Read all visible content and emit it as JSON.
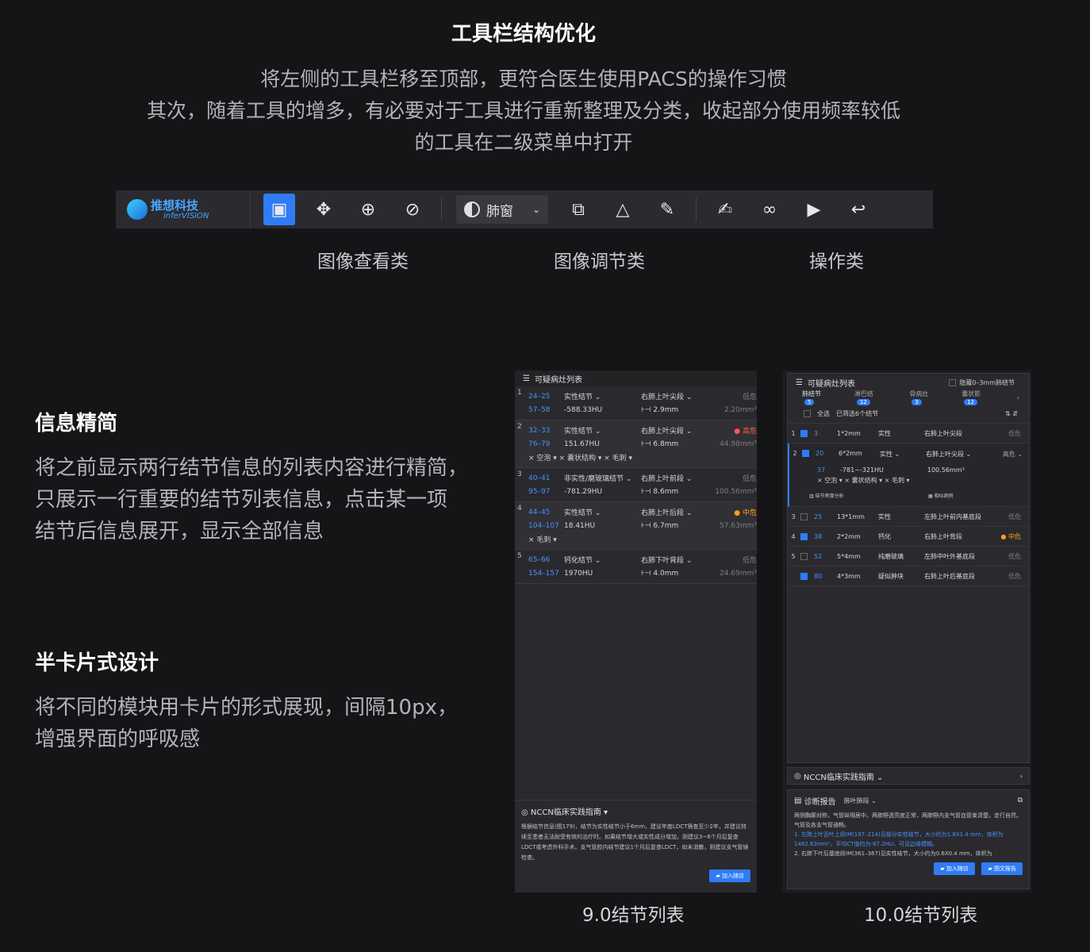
{
  "header": {
    "title": "工具栏结构优化",
    "desc_lines": [
      "将左侧的工具栏移至顶部，更符合医生使用PACS的操作习惯",
      "其次，随着工具的增多，有必要对于工具进行重新整理及分类，收起部分使用频率较低",
      "的工具在二级菜单中打开"
    ]
  },
  "toolbar": {
    "logo_cn": "推想科技",
    "logo_en": "inferVISION",
    "window_label": "肺窗",
    "categories": [
      "图像查看类",
      "图像调节类",
      "操作类"
    ]
  },
  "sections": [
    {
      "title": "信息精简",
      "lines": [
        "将之前显示两行结节信息的列表内容进行精简，",
        "只展示一行重要的结节列表信息，点击某一项",
        "结节后信息展开，显示全部信息"
      ]
    },
    {
      "title": "半卡片式设计",
      "lines": [
        "将不同的模块用卡片的形式展现，间隔10px，",
        "增强界面的呼吸感"
      ]
    }
  ],
  "p9": {
    "header": "可疑病灶列表",
    "rows": [
      {
        "n": "1",
        "a1": "24–25",
        "a2": "实性结节 ⌄",
        "a3": "右肺上叶尖段 ⌄",
        "a4": "低危",
        "b1": "57–58",
        "b2": "-588.33HU",
        "b3": "⊦⊣ 2.9mm",
        "b4": "2.20mm³",
        "tags": ""
      },
      {
        "n": "2",
        "a1": "32–33",
        "a2": "实性结节 ⌄",
        "a3": "右肺上叶尖段 ⌄",
        "a4": "● 高危",
        "b1": "76–79",
        "b2": "151.67HU",
        "b3": "⊦⊣ 6.8mm",
        "b4": "44.98mm³",
        "tags": "× 空泡 ▾   × 囊状结构 ▾   × 毛刺 ▾"
      },
      {
        "n": "3",
        "a1": "40–41",
        "a2": "非实性/磨玻璃结节 ⌄",
        "a3": "右肺上叶前段 ⌄",
        "a4": "低危",
        "b1": "95–97",
        "b2": "-781.29HU",
        "b3": "⊦⊣ 8.6mm",
        "b4": "100.56mm³",
        "tags": ""
      },
      {
        "n": "4",
        "a1": "44–45",
        "a2": "实性结节 ⌄",
        "a3": "右肺上叶后段 ⌄",
        "a4": "● 中危",
        "b1": "104–107",
        "b2": "18.41HU",
        "b3": "⊦⊣ 6.7mm",
        "b4": "57.63mm³",
        "tags": "× 毛刺 ▾"
      },
      {
        "n": "5",
        "a1": "65–66",
        "a2": "钙化结节 ⌄",
        "a3": "右肺下叶背段 ⌄",
        "a4": "低危",
        "b1": "154–157",
        "b2": "1970HU",
        "b3": "⊦⊣ 4.0mm",
        "b4": "24.69mm³",
        "tags": ""
      }
    ],
    "nccn_title": "NCCN临床实践指南 ▾",
    "nccn_text": "根据结节信息(图179)，结节为实性结节小于6mm，建议年度LDCT筛查至少2年，并建议持续至患者无法耐受有效的治疗时。如果结节增大或实性成分增加，则建议3~6个月后复查LDCT或考虑外科手术。支气管腔内结节建议1个月后复查LDCT，如未消散，则建议支气管镜检查。",
    "button": "加入随访"
  },
  "p10": {
    "header": "可疑病灶列表",
    "hide_label": "隐藏0–3mm肺结节",
    "tabs": [
      {
        "label": "肺结节",
        "count": "5"
      },
      {
        "label": "淋巴结",
        "count": "12"
      },
      {
        "label": "骨病灶",
        "count": "3"
      },
      {
        "label": "囊状影",
        "count": "12"
      }
    ],
    "select_all": "全选",
    "filter_text": "已筛选6个结节",
    "rows": [
      {
        "n": "1",
        "c": "3",
        "s": "1*2mm",
        "t": "实性",
        "l": "右肺上叶尖段",
        "r": "低危"
      },
      {
        "n": "2",
        "c": "20",
        "s": "6*2mm",
        "t": "实性 ⌄",
        "l": "右肺上叶尖段 ⌄",
        "r": "高危 ⌄"
      },
      {
        "n": "3",
        "c": "25",
        "s": "13*1mm",
        "t": "实性",
        "l": "左肺上叶前内基底段",
        "r": "低危"
      },
      {
        "n": "4",
        "c": "38",
        "s": "2*2mm",
        "t": "钙化",
        "l": "右肺上叶背段",
        "r": "● 中危"
      },
      {
        "n": "5",
        "c": "52",
        "s": "5*4mm",
        "t": "纯磨玻璃",
        "l": "左肺中叶外基底段",
        "r": "低危"
      },
      {
        "n": "",
        "c": "80",
        "s": "4*3mm",
        "t": "疑似肿块",
        "l": "右肺上叶后基底段",
        "r": "低危"
      }
    ],
    "expanded": {
      "c": "37",
      "hu": "-781~-321HU",
      "vol": "100.56mm³",
      "tags": "× 空泡 ▾   × 囊状结构 ▾   × 毛刺 ▾",
      "a1": "结节密度分析",
      "a2": "相似病例"
    },
    "nccn_title": "NCCN临床实践指南 ⌄",
    "report_title": "诊断报告",
    "report_sel": "肺叶肺段 ⌄",
    "report_text1": "两侧胸廓对称，气管纵隔居中。两肺野透亮度正常，两肺野内支气管血管束清楚，走行自然。气管及各支气管通畅。",
    "report_text2": "1. 左肺上叶舌叶上段IM(197–214)见部分实性结节，大小约为1.8X1.4 mm，体积为1462.63mm³，平均CT值约为-67.2HU，可见边缘模糊。",
    "report_text3": "2. 右肺下叶后基底段IM(361–367)见实性结节，大小约为0.6X0.4 mm，体积为",
    "btn1": "加入随访",
    "btn2": "图文报告"
  },
  "captions": {
    "p9": "9.0结节列表",
    "p10": "10.0结节列表"
  }
}
